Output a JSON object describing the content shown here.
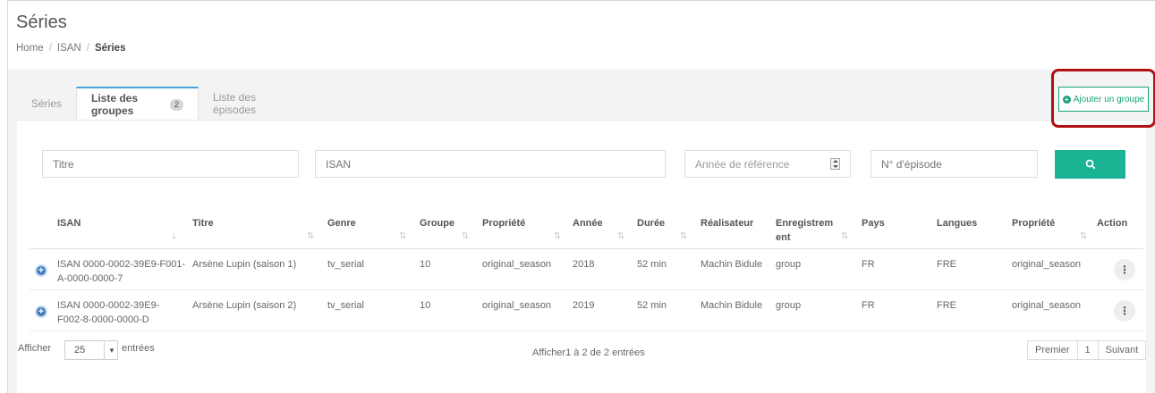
{
  "page": {
    "title": "Séries"
  },
  "breadcrumb": {
    "home": "Home",
    "isan": "ISAN",
    "current": "Séries",
    "separator": "/"
  },
  "tabs": [
    {
      "label": "Séries",
      "active": false
    },
    {
      "label": "Liste des groupes",
      "badge": "2",
      "active": true
    },
    {
      "label": "Liste des épisodes",
      "active": false
    }
  ],
  "add_group_button": {
    "label": "Ajouter un groupe",
    "icon": "plus-circle-icon"
  },
  "filters": {
    "titre_placeholder": "Titre",
    "isan_placeholder": "ISAN",
    "annee_placeholder": "Année de référence",
    "episode_placeholder": "N° d'épisode",
    "search_icon": "search-icon"
  },
  "table": {
    "columns": {
      "isan": "ISAN",
      "titre": "Titre",
      "genre": "Genre",
      "groupe": "Groupe",
      "propriete1": "Propriété",
      "annee": "Année",
      "duree": "Durée",
      "realisateur": "Réalisateur",
      "enregistrement_l1": "Enregistrem",
      "enregistrement_l2": "ent",
      "pays": "Pays",
      "langues": "Langues",
      "propriete2": "Propriété",
      "action": "Action"
    },
    "rows": [
      {
        "isan_l1": "ISAN 0000-0002-39E9-F001-",
        "isan_l2": "A-0000-0000-7",
        "titre": "Arsène Lupin (saison 1)",
        "genre": "tv_serial",
        "groupe": "10",
        "propriete1": "original_season",
        "annee": "2018",
        "duree": "52 min",
        "realisateur": "Machin Bidule",
        "enregistrement": "group",
        "pays": "FR",
        "langues": "FRE",
        "propriete2": "original_season",
        "action": "⋮"
      },
      {
        "isan_l1": "ISAN 0000-0002-39E9-",
        "isan_l2": "F002-8-0000-0000-D",
        "titre": "Arsène Lupin (saison 2)",
        "genre": "tv_serial",
        "groupe": "10",
        "propriete1": "original_season",
        "annee": "2019",
        "duree": "52 min",
        "realisateur": "Machin Bidule",
        "enregistrement": "group",
        "pays": "FR",
        "langues": "FRE",
        "propriete2": "original_season",
        "action": "⋮"
      }
    ]
  },
  "footer": {
    "afficher": "Afficher",
    "page_size": "25",
    "entries": "entrées",
    "info": "Afficher1 à 2 de 2 entrées",
    "pager": {
      "first": "Premier",
      "current": "1",
      "next": "Suivant"
    }
  },
  "colors": {
    "accent_green": "#1ab394",
    "tab_blue": "#4aa3df",
    "highlight_red": "#b01014"
  }
}
